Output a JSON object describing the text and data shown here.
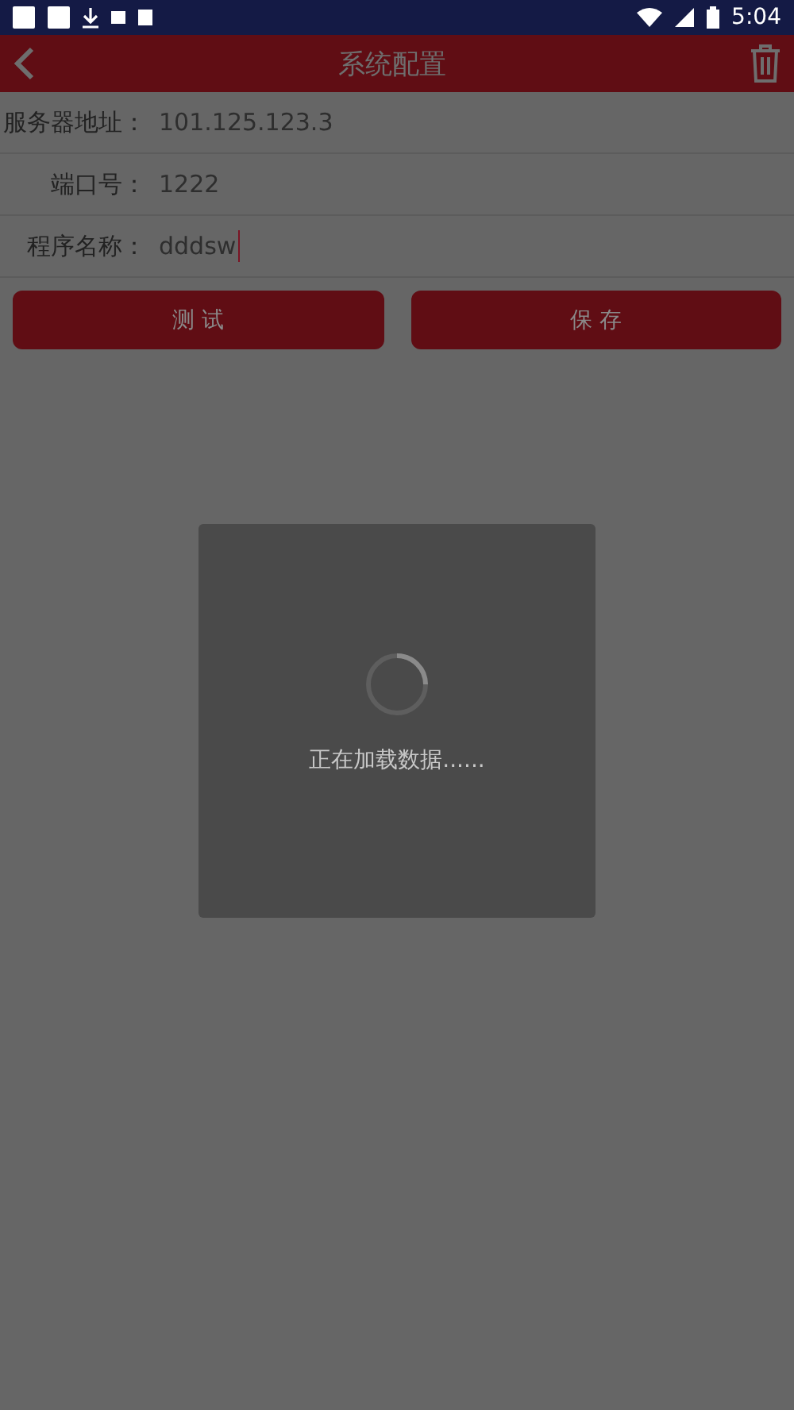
{
  "status_bar": {
    "time": "5:04"
  },
  "header": {
    "title": "系统配置"
  },
  "fields": [
    {
      "label": "服务器地址：",
      "value": "101.125.123.3",
      "focused": false
    },
    {
      "label": "端口号：",
      "value": "1222",
      "focused": false
    },
    {
      "label": "程序名称：",
      "value": "dddsw",
      "focused": true
    }
  ],
  "buttons": [
    "测 试",
    "保 存"
  ],
  "loading_dialog": {
    "message": "正在加载数据......"
  }
}
